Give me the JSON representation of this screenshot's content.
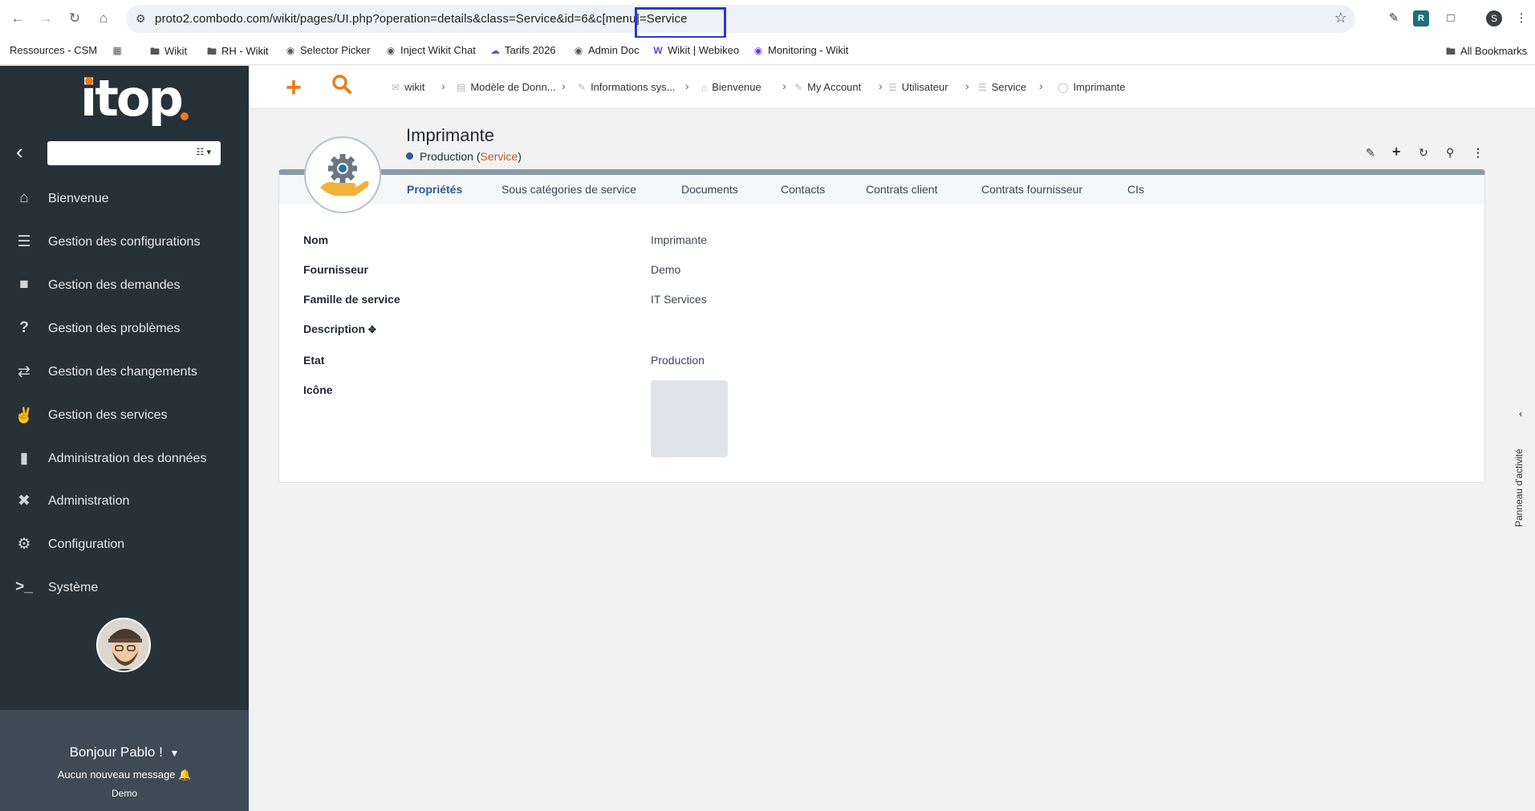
{
  "browser": {
    "url": "proto2.combodo.com/wikit/pages/UI.php?operation=details&class=Service&id=6&c[menu]=Service",
    "profile_initial": "S",
    "bookmarks": [
      {
        "label": "Ressources - CSM",
        "icon": ""
      },
      {
        "label": "",
        "icon": "apps-grid"
      },
      {
        "label": "Wikit",
        "icon": "folder"
      },
      {
        "label": "RH - Wikit",
        "icon": "folder"
      },
      {
        "label": "Selector Picker",
        "icon": "globe"
      },
      {
        "label": "Inject Wikit Chat",
        "icon": "globe"
      },
      {
        "label": "Tarifs 2026",
        "icon": "cloud"
      },
      {
        "label": "Admin Doc",
        "icon": "globe"
      },
      {
        "label": "Wikit | Webikeo",
        "icon": "w-logo"
      },
      {
        "label": "Monitoring - Wikit",
        "icon": "w-circle"
      }
    ],
    "all_bookmarks": "All Bookmarks"
  },
  "sidebar": {
    "logo": "itop",
    "menu": [
      {
        "label": "Bienvenue",
        "icon": "home-icon"
      },
      {
        "label": "Gestion des configurations",
        "icon": "database-icon"
      },
      {
        "label": "Gestion des demandes",
        "icon": "speech-bubble-icon"
      },
      {
        "label": "Gestion des problèmes",
        "icon": "question-icon"
      },
      {
        "label": "Gestion des changements",
        "icon": "exchange-icon"
      },
      {
        "label": "Gestion des services",
        "icon": "handshake-icon"
      },
      {
        "label": "Administration des données",
        "icon": "folder-icon"
      },
      {
        "label": "Administration",
        "icon": "tools-icon"
      },
      {
        "label": "Configuration",
        "icon": "gear-icon"
      },
      {
        "label": "Système",
        "icon": "terminal-icon"
      }
    ],
    "user": {
      "greeting": "Bonjour Pablo !",
      "messages": "Aucun nouveau message",
      "organization": "Demo"
    }
  },
  "breadcrumbs": [
    {
      "label": "wikit",
      "icon": "envelope-icon"
    },
    {
      "label": "Modèle de Donn...",
      "icon": "book-icon"
    },
    {
      "label": "Informations sys...",
      "icon": "wrench-icon"
    },
    {
      "label": "Bienvenue",
      "icon": "home-icon"
    },
    {
      "label": "My Account",
      "icon": "wrench-icon"
    },
    {
      "label": "Utilisateur",
      "icon": "list-icon"
    },
    {
      "label": "Service",
      "icon": "list-icon"
    },
    {
      "label": "Imprimante",
      "icon": "object-icon"
    }
  ],
  "object": {
    "title": "Imprimante",
    "status": "Production",
    "class_name": "Service",
    "tabs": [
      "Propriétés",
      "Sous catégories de service",
      "Documents",
      "Contacts",
      "Contrats client",
      "Contrats fournisseur",
      "CIs"
    ],
    "active_tab": 0,
    "fields": [
      {
        "label": "Nom",
        "value": "Imprimante",
        "link": false
      },
      {
        "label": "Fournisseur",
        "value": "Demo",
        "link": true
      },
      {
        "label": "Famille de service",
        "value": "IT Services",
        "link": true
      },
      {
        "label": "Description",
        "value": "",
        "link": false
      },
      {
        "label": "Etat",
        "value": "Production",
        "link": false
      },
      {
        "label": "Icône",
        "value": "",
        "link": false
      }
    ]
  },
  "activity_panel": {
    "label": "Panneau d'activité"
  },
  "colors": {
    "accent": "#ea7d1e",
    "link": "#c0591c",
    "sidebar": "#263238",
    "active_tab": "#2b5d94"
  }
}
